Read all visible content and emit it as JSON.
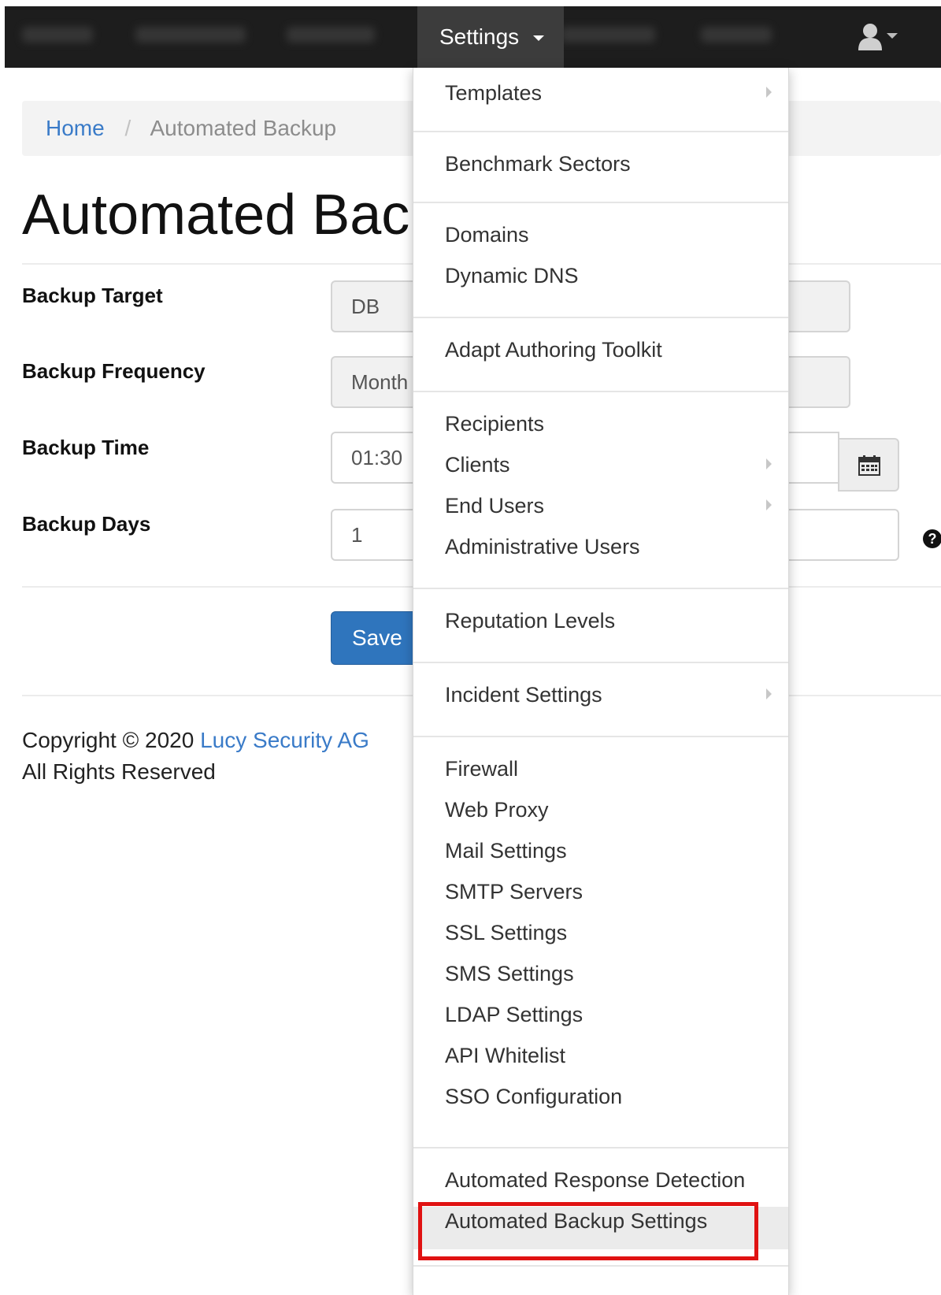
{
  "navbar": {
    "settings_label": "Settings"
  },
  "breadcrumb": {
    "home": "Home",
    "separator": "/",
    "current": "Automated Backup"
  },
  "page": {
    "title": "Automated Backup"
  },
  "form": {
    "backup_target": {
      "label": "Backup Target",
      "value": "DB"
    },
    "backup_frequency": {
      "label": "Backup Frequency",
      "value": "Month"
    },
    "backup_time": {
      "label": "Backup Time",
      "value": "01:30"
    },
    "backup_days": {
      "label": "Backup Days",
      "value": "1"
    },
    "save_label": "Save"
  },
  "footer": {
    "copyright_prefix": "Copyright © 2020",
    "company": "Lucy Security AG",
    "rights": "All Rights Reserved"
  },
  "settings_menu": {
    "items": [
      "Templates",
      "Benchmark Sectors",
      "Domains",
      "Dynamic DNS",
      "Adapt Authoring Toolkit",
      "Recipients",
      "Clients",
      "End Users",
      "Administrative Users",
      "Reputation Levels",
      "Incident Settings",
      "Firewall",
      "Web Proxy",
      "Mail Settings",
      "SMTP Servers",
      "SSL Settings",
      "SMS Settings",
      "LDAP Settings",
      "API Whitelist",
      "SSO Configuration",
      "Automated Response Detection",
      "Automated Backup Settings"
    ],
    "active_item": "Automated Backup Settings"
  },
  "colors": {
    "navbar_bg": "#1d1d1d",
    "link": "#3a7bc8",
    "primary_button": "#2f75bd",
    "highlight_outline": "#e01212"
  },
  "icons": [
    "user-icon",
    "caret-down-icon",
    "calendar-icon",
    "question-circle-icon",
    "chevron-right-icon"
  ]
}
